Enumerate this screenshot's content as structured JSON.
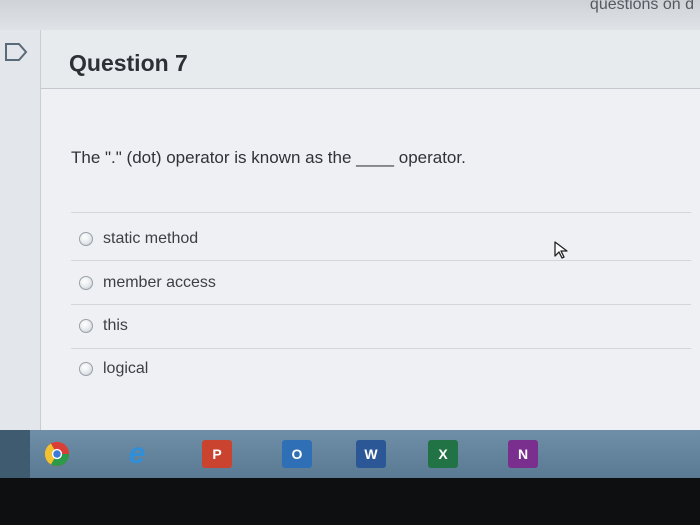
{
  "browser_top": {
    "cutoff_text": "questions on d"
  },
  "question": {
    "title": "Question 7",
    "prompt_before": "The \".\" (dot) operator is known as the",
    "blank": "____",
    "prompt_after": " operator."
  },
  "options": [
    {
      "label": "static method"
    },
    {
      "label": "member access"
    },
    {
      "label": "this"
    },
    {
      "label": "logical"
    }
  ],
  "taskbar": {
    "apps": [
      {
        "name": "chrome",
        "letter": ""
      },
      {
        "name": "internet-explorer",
        "letter": "e"
      },
      {
        "name": "powerpoint",
        "letter": "P"
      },
      {
        "name": "outlook",
        "letter": "O"
      },
      {
        "name": "word",
        "letter": "W"
      },
      {
        "name": "excel",
        "letter": "X"
      },
      {
        "name": "onenote",
        "letter": "N"
      }
    ]
  },
  "colors": {
    "powerpoint": "#c9432f",
    "outlook": "#2f6fb6",
    "word": "#2b5797",
    "excel": "#217346",
    "onenote": "#7a2f8e"
  }
}
